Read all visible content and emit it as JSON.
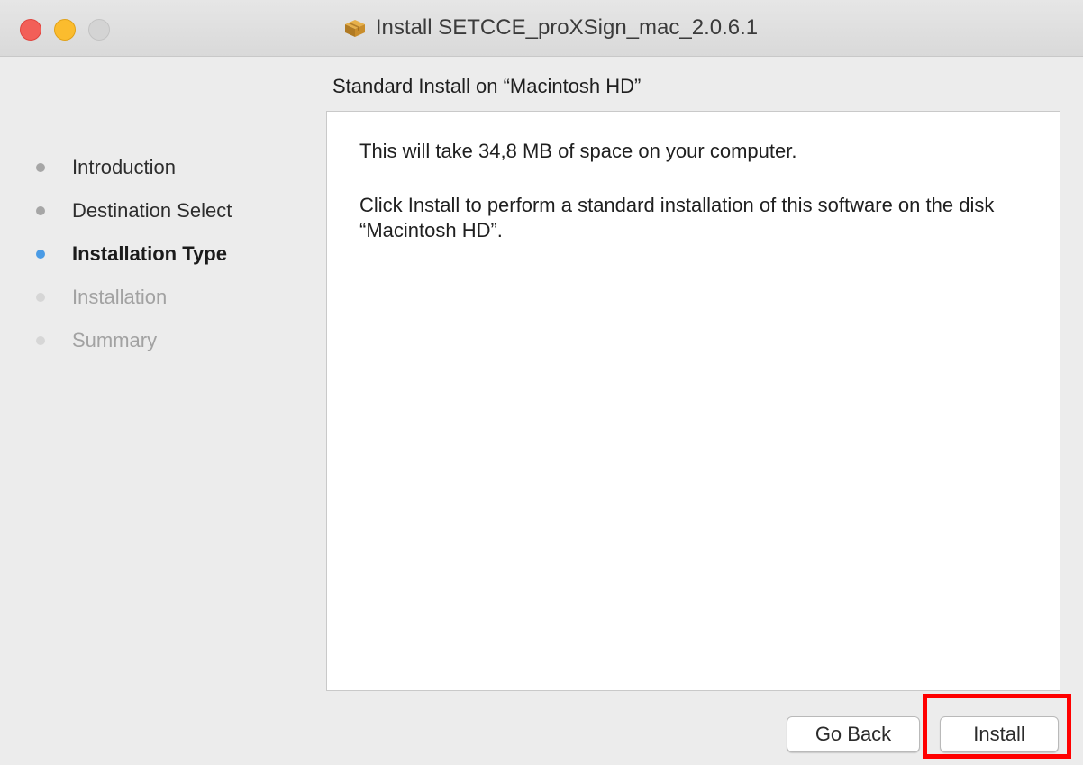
{
  "window": {
    "title": "Install SETCCE_proXSign_mac_2.0.6.1",
    "icon": "package-icon",
    "traffic_lights": {
      "close_color": "#f25f58",
      "minimize_color": "#fbbc2e",
      "zoom_color": "#d4d4d4"
    }
  },
  "header": {
    "subtitle": "Standard Install on “Macintosh HD”"
  },
  "sidebar": {
    "steps": [
      {
        "label": "Introduction",
        "state": "done"
      },
      {
        "label": "Destination Select",
        "state": "done"
      },
      {
        "label": "Installation Type",
        "state": "current"
      },
      {
        "label": "Installation",
        "state": "pending"
      },
      {
        "label": "Summary",
        "state": "pending"
      }
    ],
    "current_dot_color": "#4a9be5"
  },
  "content": {
    "space_text": "This will take 34,8 MB of space on your computer.",
    "instruction_text": "Click Install to perform a standard installation of this software on the disk “Macintosh HD”."
  },
  "buttons": {
    "go_back_label": "Go Back",
    "install_label": "Install"
  },
  "annotation": {
    "highlight_color": "#ff0000",
    "highlight_target": "install-button"
  }
}
